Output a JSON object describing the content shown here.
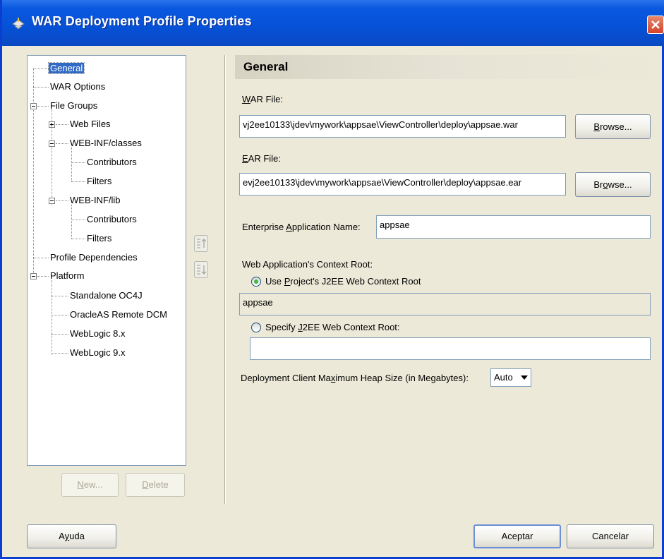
{
  "window": {
    "title": "WAR Deployment Profile Properties"
  },
  "tree": {
    "items": [
      {
        "label": "General",
        "selected": true
      },
      {
        "label": "WAR Options"
      },
      {
        "label": "File Groups"
      },
      {
        "label": "Web Files"
      },
      {
        "label": "WEB-INF/classes"
      },
      {
        "label": "Contributors"
      },
      {
        "label": "Filters"
      },
      {
        "label": "WEB-INF/lib"
      },
      {
        "label": "Contributors"
      },
      {
        "label": "Filters"
      },
      {
        "label": "Profile Dependencies"
      },
      {
        "label": "Platform"
      },
      {
        "label": "Standalone OC4J"
      },
      {
        "label": "OracleAS Remote DCM"
      },
      {
        "label": "WebLogic 8.x"
      },
      {
        "label": "WebLogic 9.x"
      }
    ],
    "new_label_pre": "",
    "new_label_u": "N",
    "new_label_post": "ew...",
    "delete_label_pre": "",
    "delete_label_u": "D",
    "delete_label_post": "elete"
  },
  "panel": {
    "heading": "General",
    "war_label_u": "W",
    "war_label_post": "AR File:",
    "war_value": "vj2ee10133\\jdev\\mywork\\appsae\\ViewController\\deploy\\appsae.war",
    "browse_pre": "",
    "browse_u": "B",
    "browse_post": "rowse...",
    "ear_label_u": "E",
    "ear_label_post": "AR File:",
    "ear_value": "evj2ee10133\\jdev\\mywork\\appsae\\ViewController\\deploy\\appsae.ear",
    "browse2_pre": "Br",
    "browse2_u": "o",
    "browse2_post": "wse...",
    "app_name_pre": "Enterprise ",
    "app_name_u": "A",
    "app_name_post": "pplication Name:",
    "app_name_value": "appsae",
    "context_root_label": "Web Application's Context Root:",
    "radio1_pre": "Use ",
    "radio1_u": "P",
    "radio1_post": "roject's J2EE Web Context Root",
    "context_value": "appsae",
    "radio2_pre": "Specify ",
    "radio2_u": "J",
    "radio2_post": "2EE Web Context Root:",
    "heap_pre": "Deployment Client Ma",
    "heap_u": "x",
    "heap_post": "imum Heap Size (in Megabytes):",
    "heap_value": "Auto"
  },
  "footer": {
    "help_pre": "A",
    "help_u": "y",
    "help_post": "uda",
    "ok": "Aceptar",
    "cancel": "Cancelar"
  }
}
